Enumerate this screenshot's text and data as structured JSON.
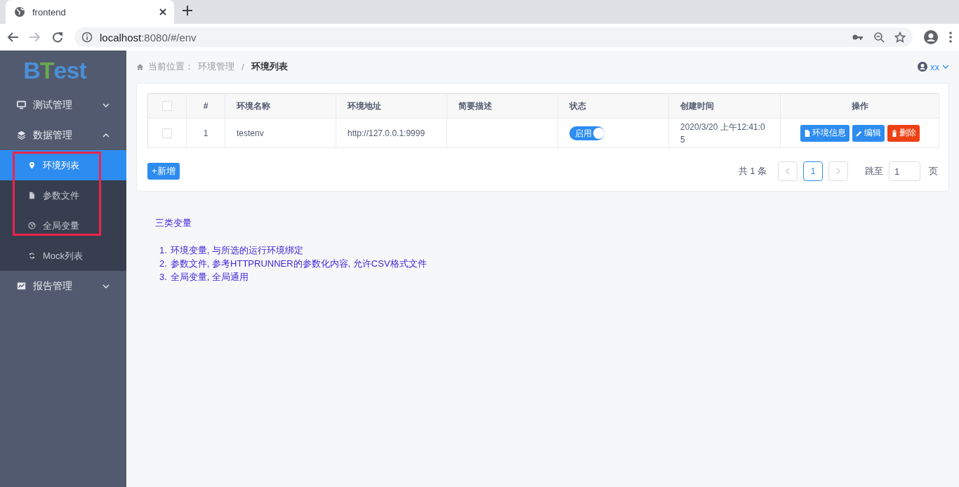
{
  "browser": {
    "tab_title": "frontend",
    "url_host": "localhost",
    "url_path": ":8080/#/env"
  },
  "sidebar": {
    "logo": "BTest",
    "menu": [
      {
        "label": "测试管理",
        "expanded": false
      },
      {
        "label": "数据管理",
        "expanded": true,
        "children": [
          {
            "label": "环境列表",
            "selected": true
          },
          {
            "label": "参数文件",
            "selected": false
          },
          {
            "label": "全局变量",
            "selected": false
          },
          {
            "label": "Mock列表",
            "selected": false
          }
        ]
      },
      {
        "label": "报告管理",
        "expanded": false
      }
    ]
  },
  "breadcrumb": {
    "prefix": "当前位置：",
    "separator": "/",
    "items": [
      "环境管理",
      "环境列表"
    ]
  },
  "user": {
    "name": "xx"
  },
  "table": {
    "select_all_checked": false,
    "columns": [
      "#",
      "环境名称",
      "环境地址",
      "简要描述",
      "状态",
      "创建时间",
      "操作"
    ],
    "rows": [
      {
        "checked": false,
        "index": "1",
        "name": "testenv",
        "address": "http://127.0.0.1:9999",
        "description": "",
        "status": {
          "on": true,
          "label": "启用"
        },
        "created": "2020/3/20 上午12:41:05",
        "actions": [
          {
            "kind": "info",
            "label": "环境信息"
          },
          {
            "kind": "edit",
            "label": "编辑"
          },
          {
            "kind": "delete",
            "label": "删除"
          }
        ]
      }
    ]
  },
  "add_button": "+新增",
  "pagination": {
    "total": "共 1 条",
    "pages": [
      {
        "label": "1",
        "selected": true
      }
    ],
    "jump_label": "跳至",
    "jump_value": "1",
    "page_suffix": "页"
  },
  "notes": {
    "title": "三类变量",
    "items": [
      {
        "marker": "1.",
        "text": "环境变量, 与所选的运行环境绑定"
      },
      {
        "marker": "2.",
        "text": "参数文件, 参考HTTPRUNNER的参数化内容, 允许CSV格式文件"
      },
      {
        "marker": "3.",
        "text": "全局变量, 全局通用"
      }
    ]
  }
}
